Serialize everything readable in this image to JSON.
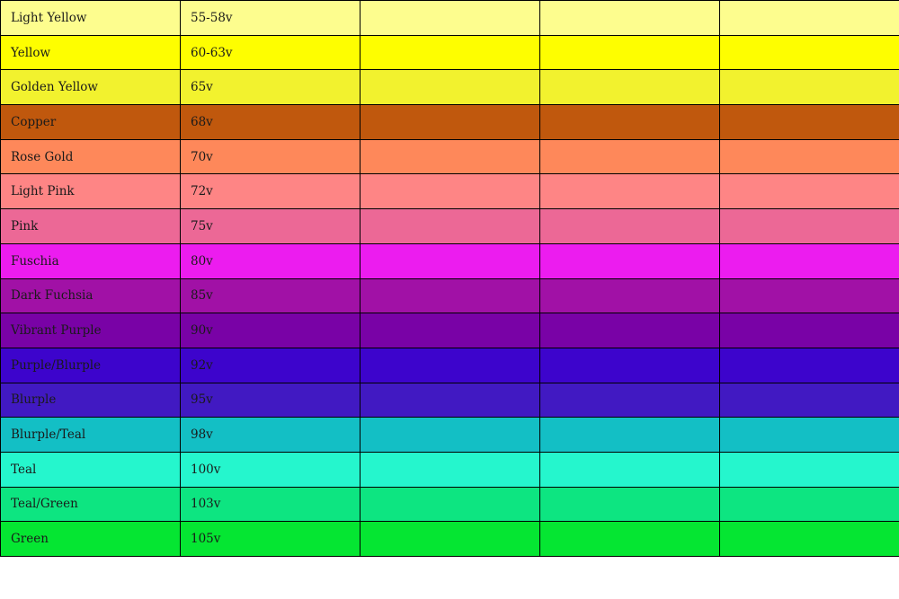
{
  "rows": [
    {
      "name": "Light Yellow",
      "voltage": "55-58v",
      "color": "#fdfd8e"
    },
    {
      "name": "Yellow",
      "voltage": "60-63v",
      "color": "#fefe00"
    },
    {
      "name": "Golden Yellow",
      "voltage": "65v",
      "color": "#f2f22e"
    },
    {
      "name": "Copper",
      "voltage": "68v",
      "color": "#c0580d"
    },
    {
      "name": "Rose Gold",
      "voltage": "70v",
      "color": "#fe885a"
    },
    {
      "name": "Light Pink",
      "voltage": "72v",
      "color": "#fe8585"
    },
    {
      "name": "Pink",
      "voltage": "75v",
      "color": "#ec6896"
    },
    {
      "name": "Fuschia",
      "voltage": "80v",
      "color": "#ec1cef"
    },
    {
      "name": "Dark Fuchsia",
      "voltage": "85v",
      "color": "#a111a6"
    },
    {
      "name": "Vibrant Purple",
      "voltage": "90v",
      "color": "#7902a6"
    },
    {
      "name": "Purple/Blurple",
      "voltage": "92v",
      "color": "#3d04cc"
    },
    {
      "name": "Blurple",
      "voltage": "95v",
      "color": "#4119c2"
    },
    {
      "name": "Blurple/Teal",
      "voltage": "98v",
      "color": "#13bfc5"
    },
    {
      "name": "Teal",
      "voltage": "100v",
      "color": "#25f6cd"
    },
    {
      "name": "Teal/Green",
      "voltage": "103v",
      "color": "#0de581"
    },
    {
      "name": "Green",
      "voltage": "105v",
      "color": "#05e632"
    }
  ]
}
